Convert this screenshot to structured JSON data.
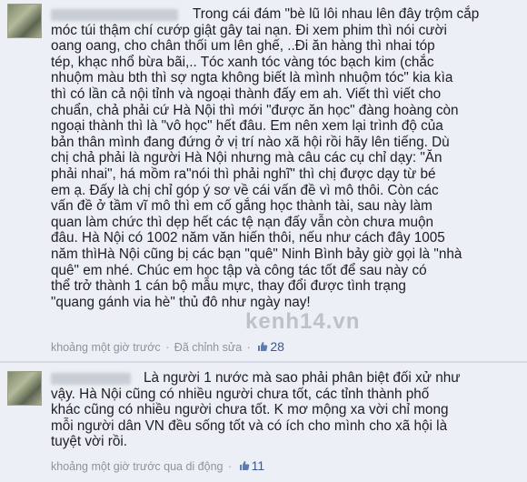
{
  "comments": [
    {
      "body": "Trong cái đám \"bè lũ lôi nhau lên đây trộm cắp\nmóc túi thậm chí cướp giật gây tai nạn. Đi xem phim thì nói cười\noang oang, cho chân thối um lên ghế, ..Đi ăn hàng thì nhai tóp\ntép, khạc nhổ bừa bãi,.. Tóc xanh tóc vàng tóc bạch kim (chắc\nnhuộm màu bth thì sợ ngta không biết là mình nhuộm tóc\" kia kìa\nthì có lần cả nội tỉnh và ngoại thành đấy em ah. Viết thì viết cho\nchuẩn, chả phải cứ Hà Nội thì mới \"được ăn học\" đàng hoàng còn\nngoại thành thì là \"vô học\" hết đâu. Em nên xem lại trình độ của\nbản thân mình đang đứng ở vị trí nào xã hội rồi hãy lên tiếng. Dù\nchị chả phải là người Hà Nội nhưng mà câu các cụ chỉ dạy: \"Ăn\nphải nhai\", há mồm ra\"nói thì phải nghĩ\" thì chị được dạy từ bé\nem ạ. Đấy là chị chỉ góp ý sơ về cái vấn đề vì mô thôi. Còn các\nvấn đề ở tầm vĩ mô thì em cố gắng học thành tài, sau này làm\nquan làm chức thì dẹp hết các tệ nạn đấy vẫn còn chưa muộn\nđâu. Hà Nội có 1002 năm văn hiến thôi, nếu như cách đây 1005\nnăm thìHà Nội cũng bị các bạn \"quê\" Ninh Bình bảy giờ gọi là \"nhà\nquê\" em nhé. Chúc em học tập và công tác tốt để sau này có\nthể trở thành 1 cán bộ mẫu mực, thay đổi được tình trạng\n\"quang gánh via hè\" thủ đô như ngày nay!",
      "time": "khoảng một giờ trước",
      "sep": "·",
      "extra": "Đã chỉnh sửa",
      "likes": "28"
    },
    {
      "body": "Là người 1 nước mà sao phải phân biệt đối xử như\nvậy. Hà Nội cũng có nhiều người chưa tốt, các tỉnh thành phố\nkhác cũng có nhiều người chưa tốt. K mơ mộng xa vời chỉ mong\nmỗi người dân VN đều sống tốt và có ích cho mình cho xã hội là\ntuyệt vời rồi.",
      "time": "khoảng một giờ trước",
      "sep": "",
      "extra": "qua di động",
      "likes": "11"
    }
  ],
  "watermark": "kenh14.vn",
  "icons": {
    "like": "thumbs-up-icon",
    "avatar": "avatar"
  }
}
